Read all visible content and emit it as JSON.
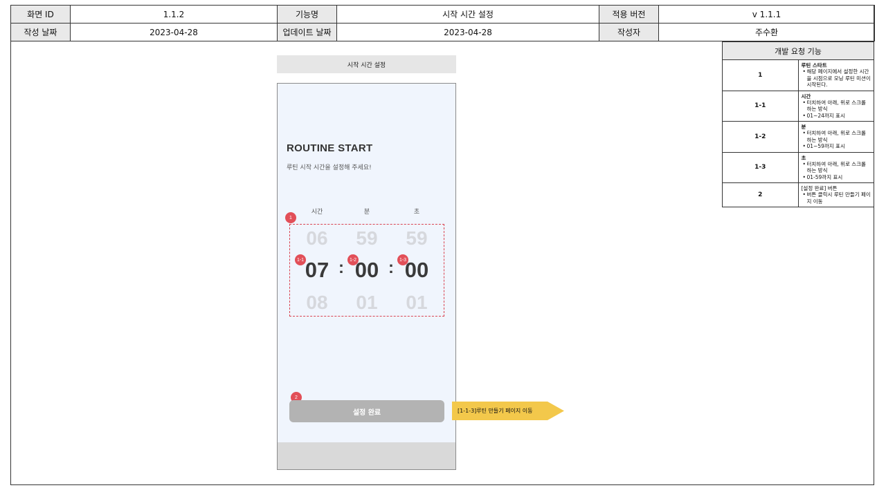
{
  "header": {
    "screen_id_label": "화면 ID",
    "screen_id": "1.1.2",
    "function_label": "기능명",
    "function_name": "시작 시간 설정",
    "version_label": "적용 버전",
    "version": "v 1.1.1",
    "created_label": "작성 날짜",
    "created": "2023-04-28",
    "updated_label": "업데이트 날짜",
    "updated": "2023-04-28",
    "author_label": "작성자",
    "author": "주수환"
  },
  "screen_tag": "시작 시간 설정",
  "phone": {
    "title": "ROUTINE START",
    "subtitle": "루틴 시작 시간을 설정해 주세요!",
    "columns": [
      "시간",
      "분",
      "초"
    ],
    "prev_values": [
      "06",
      "59",
      "59"
    ],
    "current_values": [
      "07",
      "00",
      "00"
    ],
    "next_values": [
      "08",
      "01",
      "01"
    ],
    "separator": ":",
    "done_button": "설정 완료"
  },
  "badges": {
    "group": "1",
    "hour": "1-1",
    "minute": "1-2",
    "second": "1-3",
    "button": "2"
  },
  "arrow_note": "[1-1-3]루틴 만들기 페이지 이동",
  "spec": {
    "title": "개발 요청 기능",
    "rows": [
      {
        "num": "1",
        "title": "루틴 스타트",
        "bullets": [
          "해당 페이지에서 설정한 시간을 시점으로 모닝 루틴 미션이 시작된다."
        ]
      },
      {
        "num": "1-1",
        "title": "시간",
        "bullets": [
          "터치하여 아래, 위로 스크롤 하는 방식",
          "01~24까지 표시"
        ]
      },
      {
        "num": "1-2",
        "title": "분",
        "bullets": [
          "터치하여 아래, 위로 스크롤 하는 방식",
          "01~59까지 표시"
        ]
      },
      {
        "num": "1-3",
        "title": "초",
        "bullets": [
          "터치하여 아래, 위로 스크롤 하는 방식",
          "01-59까지 표시"
        ]
      },
      {
        "num": "2",
        "title": "[설정 완료] 버튼",
        "bullets": [
          "버튼 클릭시 루틴 만들기 페이지 이동"
        ]
      }
    ]
  },
  "colors": {
    "badge": "#e24f58",
    "dashed_box": "#d9414f",
    "phone_bg": "#f0f5fd",
    "button_bg": "#b3b3b3",
    "arrow": "#f3c84b"
  }
}
